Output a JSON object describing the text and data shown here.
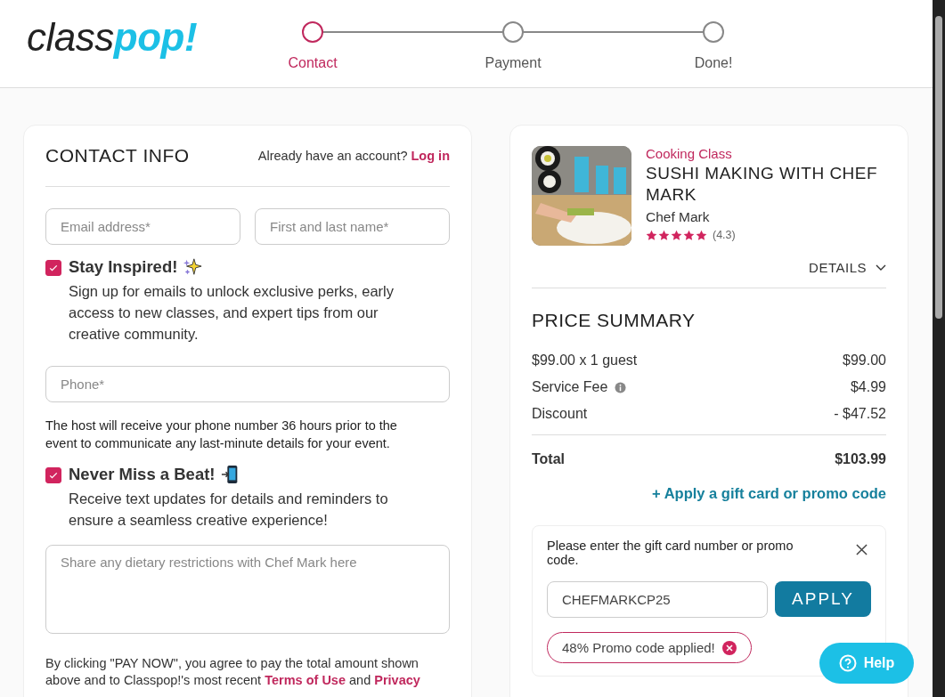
{
  "logo": {
    "part1": "class",
    "part2": "pop!"
  },
  "steps": [
    {
      "label": "Contact",
      "selected": true
    },
    {
      "label": "Payment",
      "selected": false
    },
    {
      "label": "Done!",
      "selected": false
    }
  ],
  "contact": {
    "title": "CONTACT INFO",
    "account_prompt": "Already have an account?",
    "login_link": "Log in",
    "email": {
      "placeholder": "Email address*"
    },
    "name": {
      "placeholder": "First and last name*"
    },
    "email_optin": {
      "checked": true,
      "title": "Stay Inspired!",
      "text": "Sign up for emails to unlock exclusive perks, early access to new classes, and expert tips from our creative community."
    },
    "phone": {
      "placeholder": "Phone*"
    },
    "phone_note": "The host will receive your phone number 36 hours prior to the event to communicate any last-minute details for your event.",
    "sms_optin": {
      "checked": true,
      "title": "Never Miss a Beat!",
      "text": "Receive text updates for details and reminders to ensure a seamless creative experience!"
    },
    "notes": {
      "placeholder": "Share any dietary restrictions with Chef Mark here"
    },
    "legal": {
      "text": "By clicking \"PAY NOW\", you agree to pay the total amount shown above and to Classpop!'s most recent ",
      "link1": "Terms of Use",
      "between": " and ",
      "link2": "Privacy"
    }
  },
  "class": {
    "kind": "picture",
    "category": "Cooking Class",
    "title": "SUSHI MAKING WITH CHEF MARK",
    "chef": "Chef Mark",
    "stars": 5,
    "rating": "(4.3)",
    "details": "DETAILS"
  },
  "price_summary": {
    "title": "PRICE SUMMARY",
    "rows": [
      {
        "label": "$99.00 x 1 guest",
        "value": "$99.00",
        "info": false
      },
      {
        "label": "Service Fee",
        "value": "$4.99",
        "info": true
      },
      {
        "label": "Discount",
        "value": "- $47.52",
        "info": false
      }
    ],
    "total": {
      "label": "Total",
      "value": "$103.99"
    },
    "promo_link": "+ Apply a gift card or promo code"
  },
  "promo": {
    "prompt": "Please enter the gift card number or promo code.",
    "value": "CHEFMARKCP25",
    "button": "APPLY",
    "applied": "48% Promo code applied!"
  },
  "help": {
    "label": "Help"
  }
}
